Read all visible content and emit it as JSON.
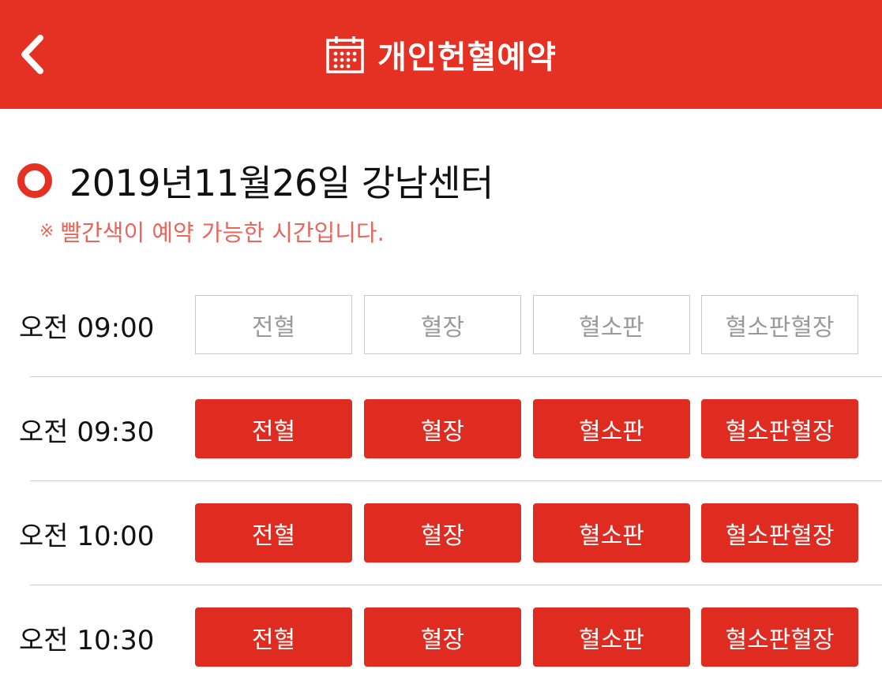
{
  "header": {
    "title": "개인헌혈예약",
    "back_icon": "chevron-left-icon",
    "title_icon": "calendar-icon",
    "bg_color": "#e53123"
  },
  "date_heading": "2019년11월26일 강남센터",
  "notice": {
    "mark": "※",
    "text": "빨간색이 예약 가능한 시간입니다."
  },
  "slots": [
    {
      "time": "오전 09:00",
      "options": [
        {
          "label": "전혈",
          "available": false
        },
        {
          "label": "혈장",
          "available": false
        },
        {
          "label": "혈소판",
          "available": false
        },
        {
          "label": "혈소판혈장",
          "available": false
        }
      ]
    },
    {
      "time": "오전 09:30",
      "options": [
        {
          "label": "전혈",
          "available": true
        },
        {
          "label": "혈장",
          "available": true
        },
        {
          "label": "혈소판",
          "available": true
        },
        {
          "label": "혈소판혈장",
          "available": true
        }
      ]
    },
    {
      "time": "오전 10:00",
      "options": [
        {
          "label": "전혈",
          "available": true
        },
        {
          "label": "혈장",
          "available": true
        },
        {
          "label": "혈소판",
          "available": true
        },
        {
          "label": "혈소판혈장",
          "available": true
        }
      ]
    },
    {
      "time": "오전 10:30",
      "options": [
        {
          "label": "전혈",
          "available": true
        },
        {
          "label": "혈장",
          "available": true
        },
        {
          "label": "혈소판",
          "available": true
        },
        {
          "label": "혈소판혈장",
          "available": true
        }
      ]
    }
  ]
}
